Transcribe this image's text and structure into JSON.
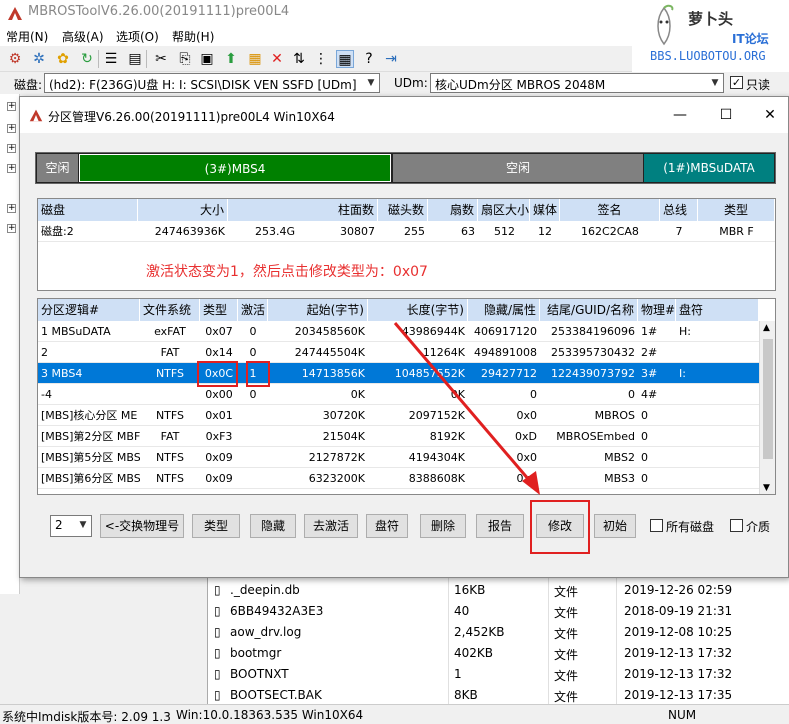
{
  "app": {
    "title": "MBROSToolV6.26.00(20191111)pre00L4"
  },
  "watermark": {
    "brand": "萝卜头",
    "sub": "IT论坛",
    "url": "BBS.LUOBOTOU.ORG"
  },
  "menu": [
    "常用(N)",
    "高级(A)",
    "选项(O)",
    "帮助(H)"
  ],
  "toolbar": {
    "icons": [
      "gear-icon",
      "gear-settings-icon",
      "puzzle-icon",
      "refresh-icon",
      "list-icon",
      "document-icon",
      "scissors-icon",
      "copy-icon",
      "paste-icon",
      "up-arrow-icon",
      "lock-icon",
      "delete-x-icon",
      "swap-icon",
      "tree-icon",
      "grid-icon",
      "help-icon",
      "exit-icon"
    ]
  },
  "diskbar": {
    "disk_label": "磁盘:",
    "disk_value": "(hd2): F(236G)U盘  H: I: SCSI\\DISK  VEN SSFD [UDm]",
    "udm_label": "UDm:",
    "udm_value": "核心UDm分区 MBROS 2048M",
    "readonly_label": "只读",
    "readonly_checked": true
  },
  "dialog": {
    "title": "分区管理V6.26.00(20191111)pre00L4 Win10X64",
    "strip": [
      {
        "label": "空闲",
        "color": "#808080"
      },
      {
        "label": "(3#)MBS4",
        "color": "#008000"
      },
      {
        "label": "空闲",
        "color": "#808080"
      },
      {
        "label": "(1#)MBSuDATA",
        "color": "#008080"
      }
    ],
    "disk_table": {
      "headers": [
        "磁盘",
        "大小",
        "柱面数",
        "磁头数",
        "扇数",
        "扇区大小",
        "媒体",
        "签名",
        "总线",
        "类型"
      ],
      "row": [
        "磁盘:2",
        "247463936K",
        "253.4G",
        "30807",
        "255",
        "63",
        "512",
        "12",
        "162C2CA8",
        "7",
        "MBR F"
      ]
    },
    "annotation": "激活状态变为1，然后点击修改类型为：0x07",
    "part_table": {
      "headers": [
        "分区逻辑#",
        "文件系统",
        "类型",
        "激活",
        "起始(字节)",
        "长度(字节)",
        "隐藏/属性",
        "结尾/GUID/名称",
        "物理#",
        "盘符"
      ],
      "rows": [
        [
          "1 MBSuDATA",
          "exFAT",
          "0x07",
          "0",
          "203458560K",
          "43986944K",
          "406917120",
          "253384196096",
          "1#",
          "H:"
        ],
        [
          "2",
          "FAT",
          "0x14",
          "0",
          "247445504K",
          "11264K",
          "494891008",
          "253395730432",
          "2#",
          ""
        ],
        [
          "3 MBS4",
          "NTFS",
          "0x0C",
          "1",
          "14713856K",
          "104857552K",
          "29427712",
          "122439073792",
          "3#",
          "I:"
        ],
        [
          "-4",
          "",
          "0x00",
          "0",
          "0K",
          "0K",
          "0",
          "0",
          "4#",
          ""
        ],
        [
          "[MBS]核心分区 ME",
          "NTFS",
          "0x01",
          "",
          "30720K",
          "2097152K",
          "0x0",
          "MBROS",
          "0",
          ""
        ],
        [
          "[MBS]第2分区 MBF",
          "FAT",
          "0xF3",
          "",
          "21504K",
          "8192K",
          "0xD",
          "MBROSEmbed",
          "0",
          ""
        ],
        [
          "[MBS]第5分区 MBS",
          "NTFS",
          "0x09",
          "",
          "2127872K",
          "4194304K",
          "0x0",
          "MBS2",
          "0",
          ""
        ],
        [
          "[MBS]第6分区 MBS",
          "NTFS",
          "0x09",
          "",
          "6323200K",
          "8388608K",
          "0x0",
          "MBS3",
          "0",
          ""
        ]
      ],
      "selected_index": 2
    },
    "buttons": {
      "num": "2",
      "swap": "<-交换物理号",
      "type": "类型",
      "hide": "隐藏",
      "deactivate": "去激活",
      "letter": "盘符",
      "delete": "删除",
      "report": "报告",
      "modify": "修改",
      "init": "初始",
      "all_disks": "所有磁盘",
      "media": "介质"
    }
  },
  "files": [
    {
      "name": "._deepin.db",
      "size": "16KB",
      "type": "文件",
      "date": "2019-12-26 02:59"
    },
    {
      "name": "6BB49432A3E3",
      "size": "40",
      "type": "文件",
      "date": "2018-09-19 21:31"
    },
    {
      "name": "aow_drv.log",
      "size": "2,452KB",
      "type": "文件",
      "date": "2019-12-08 10:25"
    },
    {
      "name": "bootmgr",
      "size": "402KB",
      "type": "文件",
      "date": "2019-12-13 17:32"
    },
    {
      "name": "BOOTNXT",
      "size": "1",
      "type": "文件",
      "date": "2019-12-13 17:32"
    },
    {
      "name": "BOOTSECT.BAK",
      "size": "8KB",
      "type": "文件",
      "date": "2019-12-13 17:35"
    }
  ],
  "status": {
    "imdisk": "系统中Imdisk版本号: 2.09 1.3",
    "win": "Win:10.0.18363.535 Win10X64",
    "num": "NUM"
  }
}
